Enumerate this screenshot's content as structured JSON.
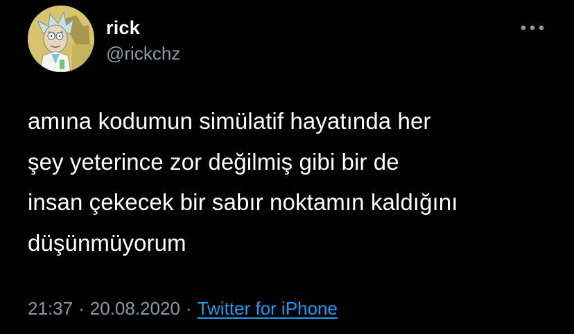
{
  "tweet": {
    "display_name": "rick",
    "handle": "@rickchz",
    "text_lines": [
      "amına kodumun simülatif hayatında her",
      "şey yeterince zor değilmiş gibi bir de",
      "insan çekecek bir sabır noktamın kaldığını",
      "düşünmüyorum"
    ],
    "time": "21:37",
    "separator": "·",
    "date": "20.08.2020",
    "source": "Twitter for iPhone"
  },
  "icons": {
    "avatar": "rick-sanchez-avatar-icon",
    "more": "more-horizontal-icon"
  },
  "colors": {
    "background": "#000000",
    "name": "#ffffff",
    "secondary": "#8b98a5",
    "link": "#1d9bf0"
  }
}
